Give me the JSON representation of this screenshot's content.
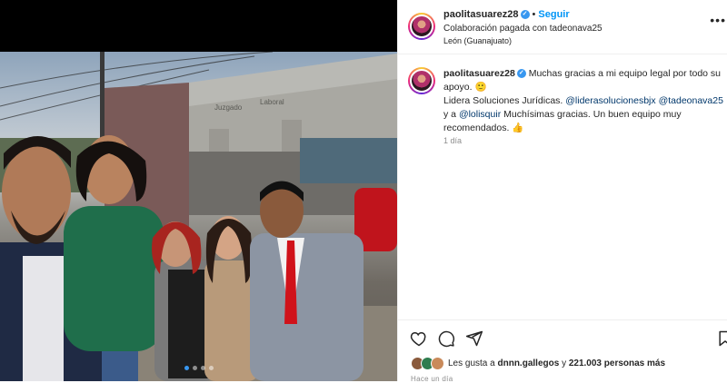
{
  "post": {
    "username": "paolitasuarez28",
    "follow_label": "Seguir",
    "paid_partnership": "Colaboración pagada con tadeonava25",
    "location": "León (Guanajuato)",
    "more_icon": "more-horizontal-icon"
  },
  "photo": {
    "building_sign_1": "Juzgado",
    "building_sign_2": "Laboral",
    "description_icon": "group-photo"
  },
  "caption": {
    "username": "paolitasuarez28",
    "line1": "Muchas gracias a mi equipo legal por todo su apoyo.",
    "line1_emoji": "🙂",
    "line2_prefix": "Lidera Soluciones Jurídicas.",
    "mention1": "@liderasolucionesbjx",
    "mention2": "@tadeonava25",
    "line3_prefix": "y a",
    "mention3": "@lolisquir",
    "line3_suffix": "Muchísimas gracias. Un buen equipo muy recomendados.",
    "line3_emoji": "👍",
    "time": "1 día"
  },
  "actions": {
    "like_icon": "heart-icon",
    "comment_icon": "comment-icon",
    "share_icon": "send-icon",
    "save_icon": "bookmark-icon",
    "likes_prefix": "Les gusta a",
    "likes_user": "dnnn.gallegos",
    "likes_conj": "y",
    "likes_count": "221.003 personas más",
    "posted_ago": "Hace un día"
  },
  "colors": {
    "accent": "#0095f6",
    "verified": "#3897f0",
    "mention": "#00376b",
    "muted": "#8e8e8e"
  }
}
